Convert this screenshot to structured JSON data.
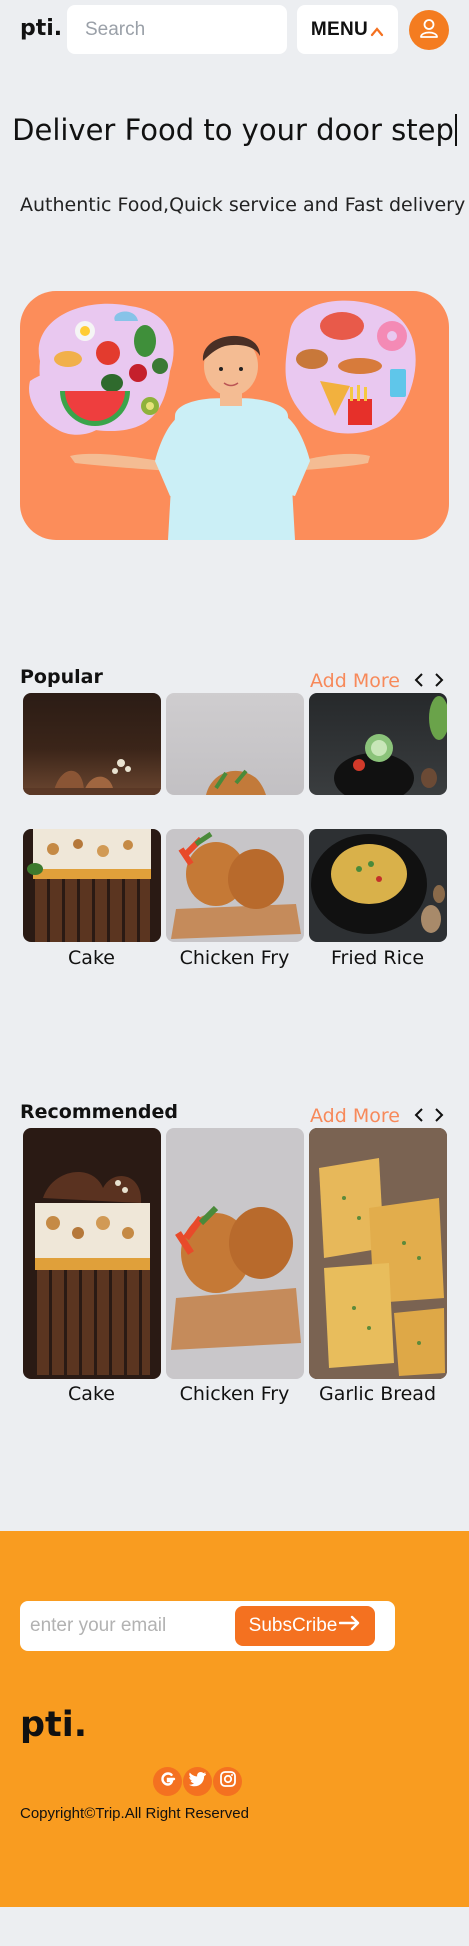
{
  "header": {
    "logo": "pti.",
    "search_placeholder": "Search",
    "menu_label": "MENU"
  },
  "hero": {
    "title": "Deliver Food to your door step",
    "subtitle": "Authentic Food,Quick service and Fast delivery"
  },
  "popular": {
    "title": "Popular",
    "add_more": "Add More",
    "items": [
      {
        "label": "Cake"
      },
      {
        "label": "Chicken Fry"
      },
      {
        "label": "Fried Rice"
      }
    ]
  },
  "recommended": {
    "title": "Recommended",
    "add_more": "Add More",
    "items": [
      {
        "label": "Cake"
      },
      {
        "label": "Chicken Fry"
      },
      {
        "label": "Garlic Bread"
      }
    ]
  },
  "footer": {
    "email_placeholder": "enter your email",
    "subscribe_label": "SubsCribe",
    "logo": "pti.",
    "copyright": "Copyright©Trip.All Right Reserved"
  },
  "colors": {
    "accent": "#f47120",
    "footer_bg": "#f99c20",
    "banner_bg": "#fc8d5a",
    "page_bg": "#eceef1"
  },
  "icons": [
    "chevron-up-icon",
    "user-icon",
    "chevron-left-icon",
    "chevron-right-icon",
    "arrow-right-icon",
    "google-icon",
    "twitter-icon",
    "instagram-icon"
  ]
}
